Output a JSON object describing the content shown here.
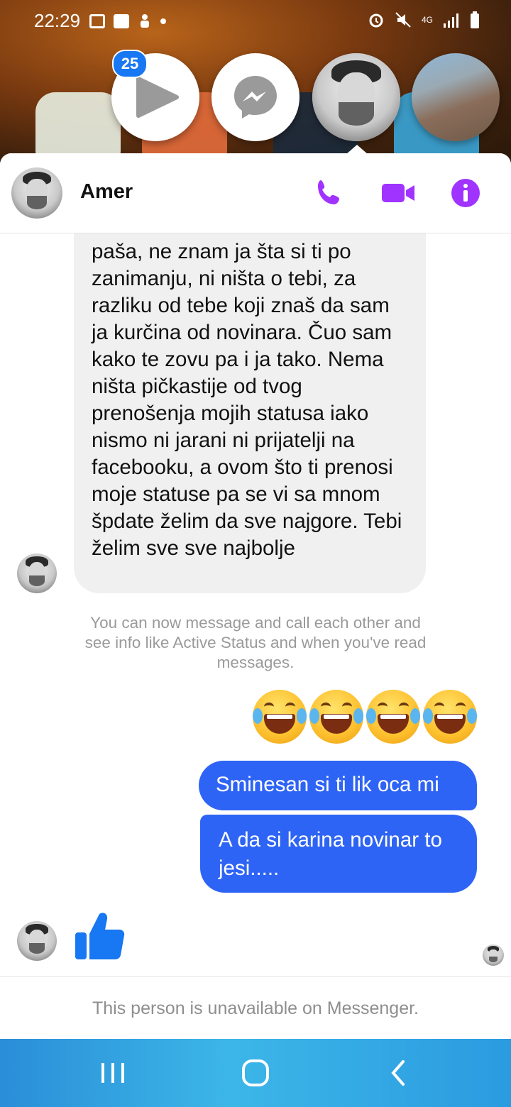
{
  "status_bar": {
    "time": "22:29",
    "network": "4G"
  },
  "chat_heads": {
    "badge_count": "25"
  },
  "header": {
    "contact_name": "Amer"
  },
  "messages": {
    "incoming_text": "paša, ne znam ja šta si ti po zanimanju, ni ništa o tebi, za razliku od tebe koji znaš da sam ja kurčina od novinara. Čuo sam kako te zovu pa i ja tako. Nema ništa pičkastije od tvog prenošenja mojih statusa iako nismo ni jarani ni prijatelji na facebooku, a ovom što ti prenosi moje statuse pa se vi sa mnom špdate želim da sve najgore. Tebi želim sve sve najbolje",
    "system_note": "You can now message and call each other and see info like Active Status and when you've read messages.",
    "emoji": "😂😂😂😂",
    "outgoing_1": "Sminesan si ti lik oca mi",
    "outgoing_2": "A da si karina novinar to jesi....."
  },
  "footer": {
    "unavailable_text": "This person is unavailable on Messenger."
  },
  "colors": {
    "messenger_purple": "#a033ff",
    "outgoing_blue": "#2e64f5",
    "thumb_blue": "#1877f2"
  }
}
